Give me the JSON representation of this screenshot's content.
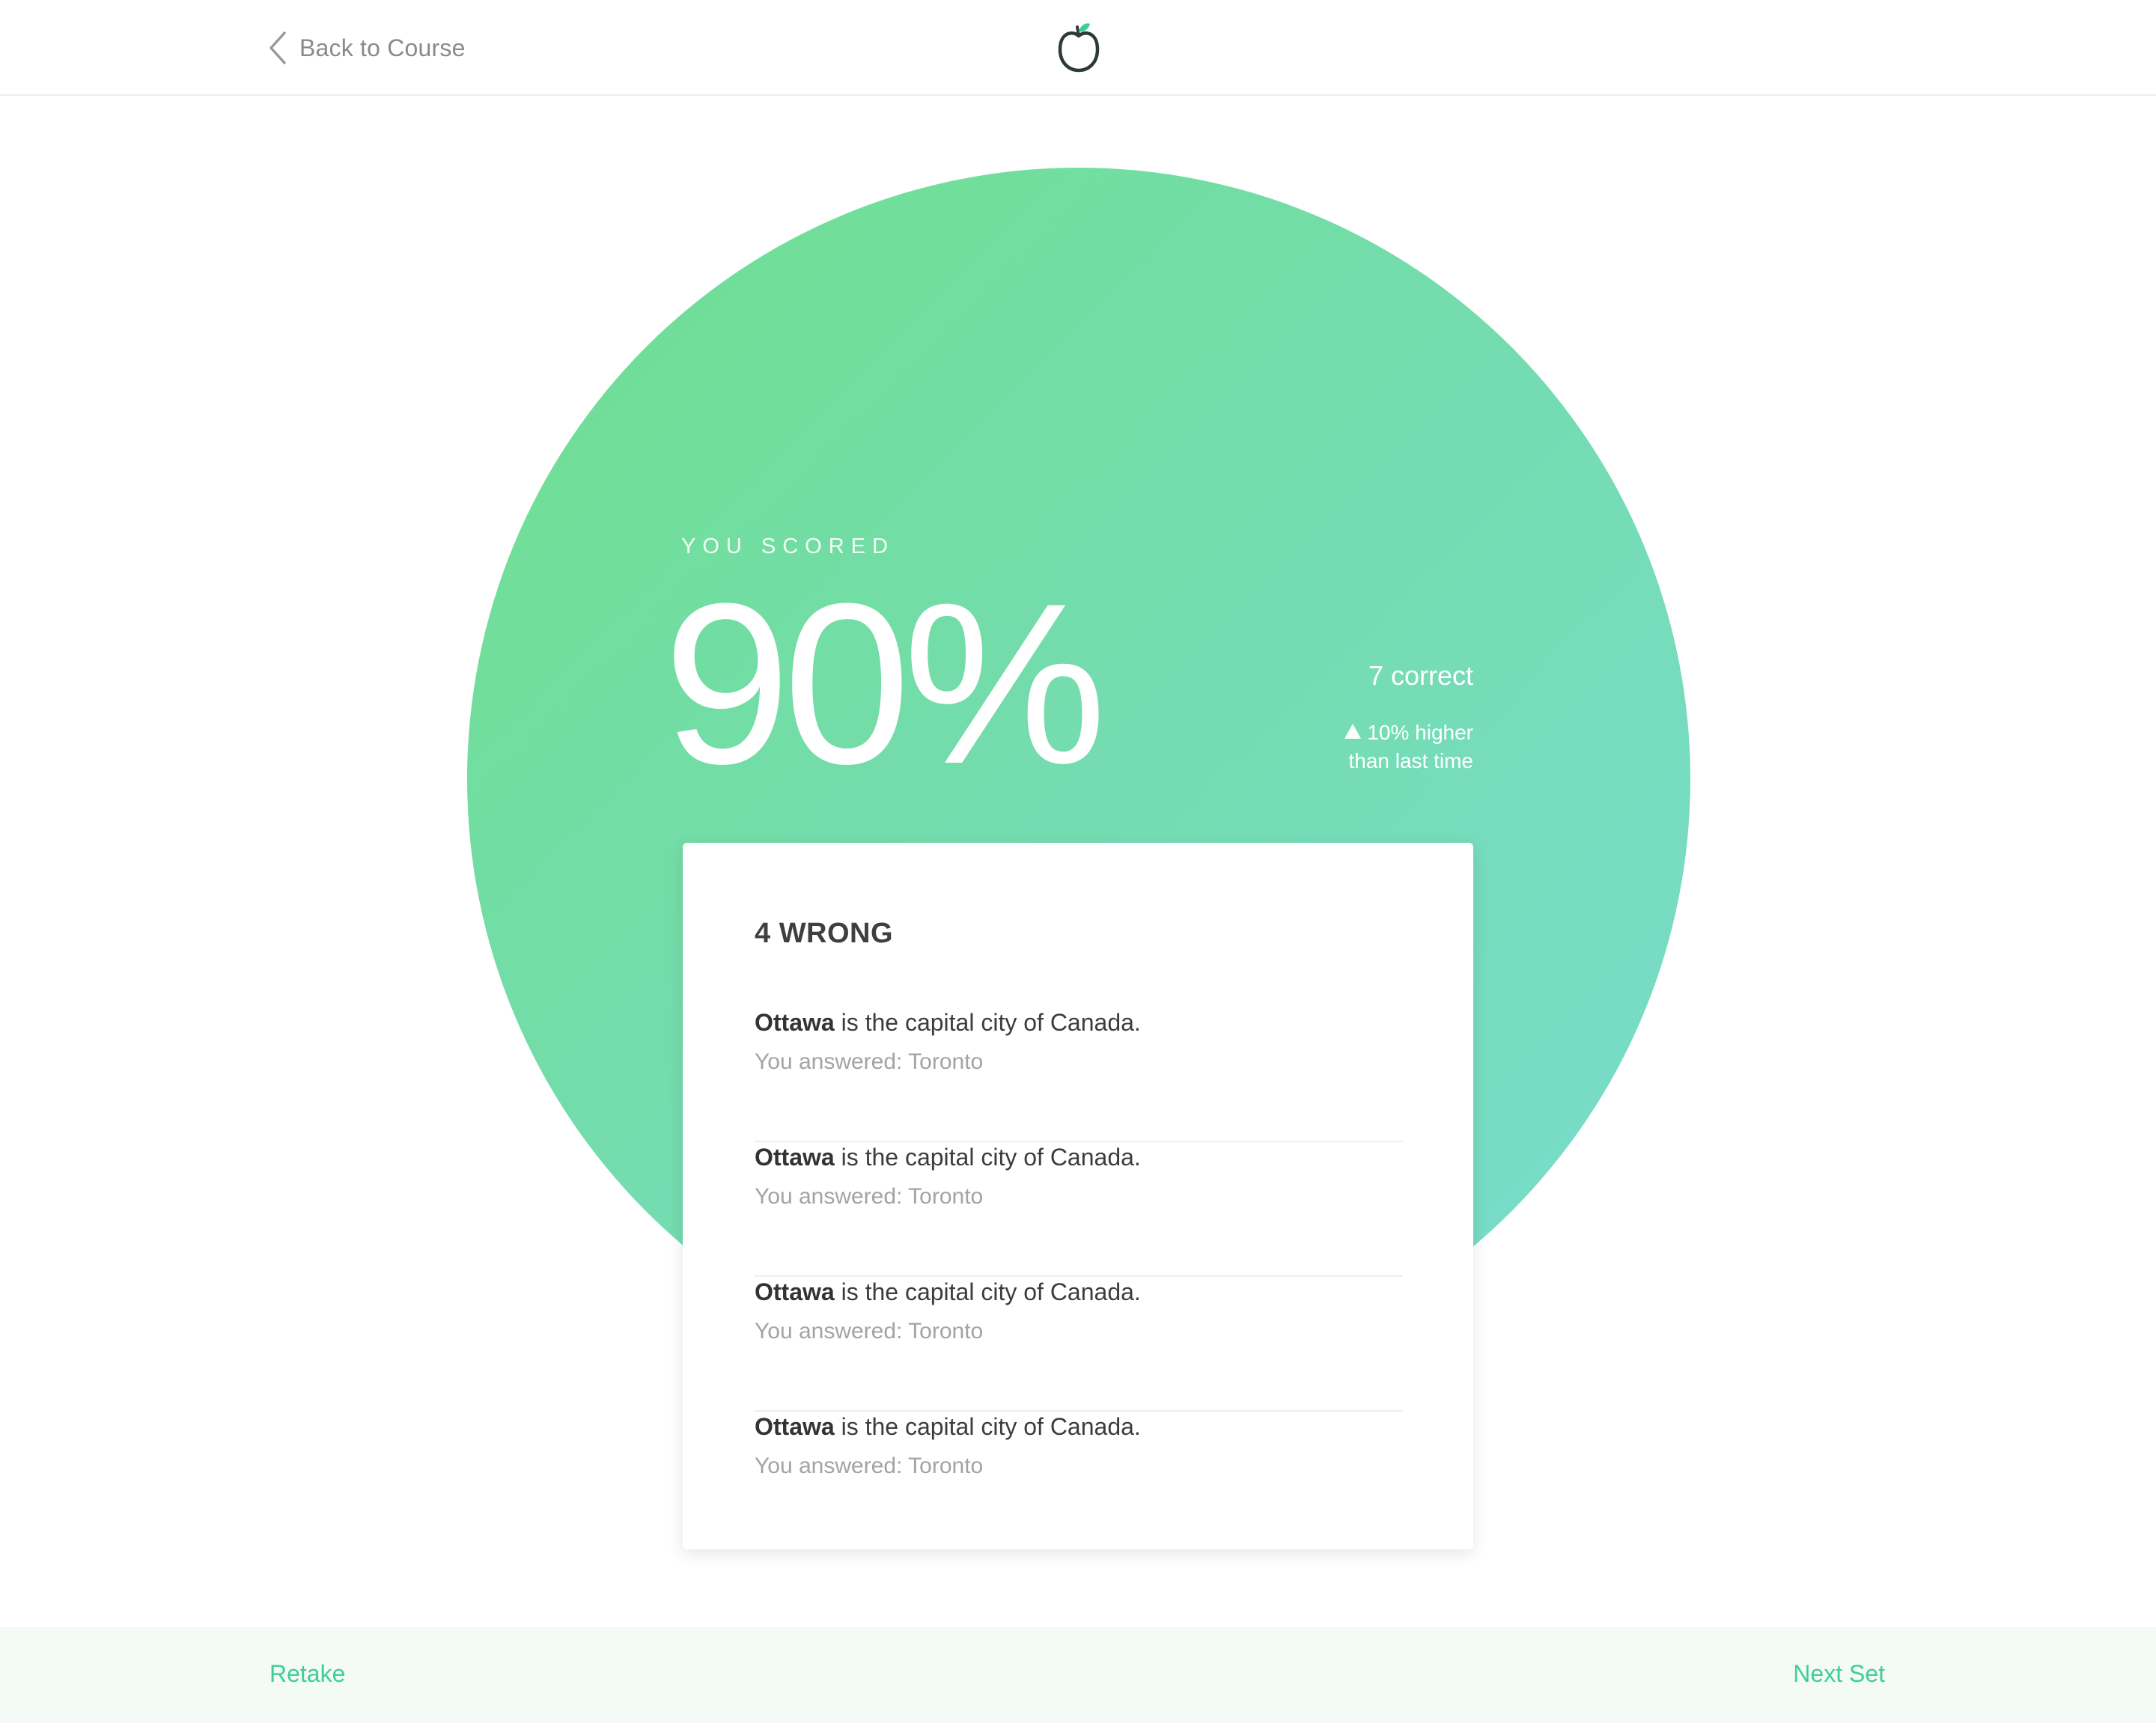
{
  "header": {
    "back_label": "Back to Course",
    "back_icon": "chevron-left-icon",
    "logo_icon": "apple-icon"
  },
  "score": {
    "label": "YOU SCORED",
    "value": "90%",
    "correct_text": "7 correct",
    "improvement_line1": "10% higher",
    "improvement_line2": "than last time",
    "improvement_icon": "up-arrow-icon"
  },
  "results": {
    "title": "4 WRONG",
    "items": [
      {
        "answer_bold": "Ottawa",
        "question_rest": " is the capital city of Canada.",
        "user_answer": "You answered: Toronto"
      },
      {
        "answer_bold": "Ottawa",
        "question_rest": " is the capital city of Canada.",
        "user_answer": "You answered: Toronto"
      },
      {
        "answer_bold": "Ottawa",
        "question_rest": " is the capital city of Canada.",
        "user_answer": "You answered: Toronto"
      },
      {
        "answer_bold": "Ottawa",
        "question_rest": " is the capital city of Canada.",
        "user_answer": "You answered: Toronto"
      }
    ]
  },
  "footer": {
    "retake_label": "Retake",
    "next_label": "Next Set"
  },
  "colors": {
    "gradient_start": "#6fdf8e",
    "gradient_end": "#79dccf",
    "accent": "#3fcf95",
    "footer_bg": "#f4faf6"
  }
}
